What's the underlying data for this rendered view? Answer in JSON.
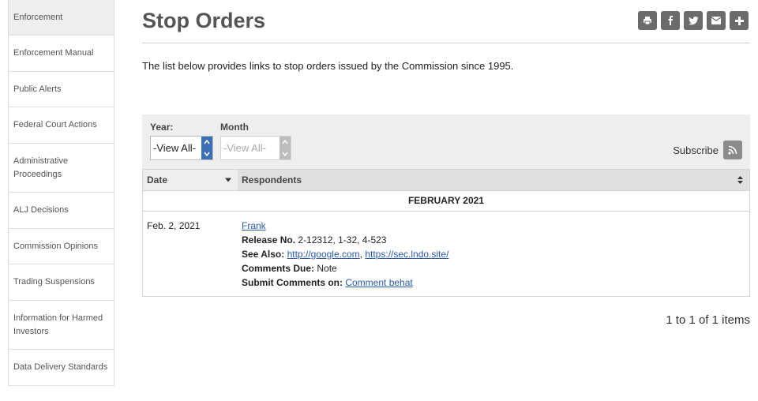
{
  "sidebar": {
    "items": [
      {
        "label": "Enforcement",
        "active": true
      },
      {
        "label": "Enforcement Manual"
      },
      {
        "label": "Public Alerts"
      },
      {
        "label": "Federal Court Actions"
      },
      {
        "label": "Administrative Proceedings"
      },
      {
        "label": "ALJ Decisions"
      },
      {
        "label": "Commission Opinions"
      },
      {
        "label": "Trading Suspensions"
      },
      {
        "label": "Information for Harmed Investors"
      },
      {
        "label": "Data Delivery Standards"
      }
    ]
  },
  "page": {
    "title": "Stop Orders",
    "intro": "The list below provides links to stop orders issued by the Commission since 1995."
  },
  "share_icons": [
    "print-icon",
    "facebook-icon",
    "twitter-icon",
    "email-icon",
    "plus-icon"
  ],
  "filters": {
    "year_label": "Year:",
    "year_value": "-View All-",
    "month_label": "Month",
    "month_value": "-View All-",
    "subscribe_label": "Subscribe",
    "subscribe_icon": "rss-icon"
  },
  "table": {
    "columns": [
      "Date",
      "Respondents"
    ],
    "group_heading": "FEBRUARY 2021",
    "rows": [
      {
        "date": "Feb. 2, 2021",
        "respondent": "Frank",
        "release_label": "Release No.",
        "release_value": "2-12312, 1-32, 4-523",
        "see_also_label": "See Also:",
        "see_also_link1": "http://google.com",
        "see_also_sep": ",",
        "see_also_link2": "https://sec.lndo.site/",
        "comments_due_label": "Comments Due:",
        "comments_due_value": "Note",
        "submit_label": "Submit Comments on:",
        "submit_link": "Comment behat"
      }
    ]
  },
  "pager": {
    "text": "1 to 1 of 1 items"
  },
  "colors": {
    "accent_blue": "#3b6fb6",
    "link": "#2a5aa8",
    "button_gray": "#6b6b6b"
  }
}
